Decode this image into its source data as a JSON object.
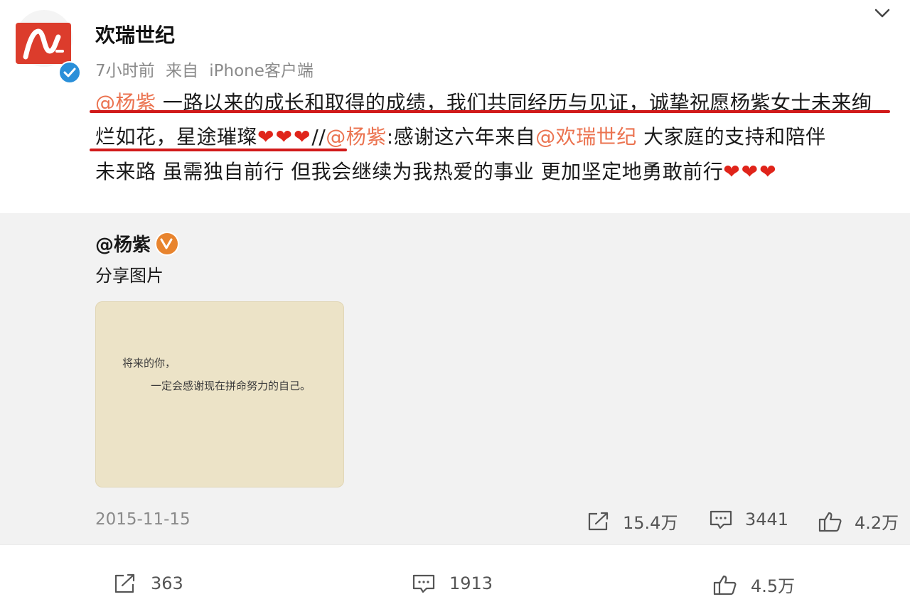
{
  "post": {
    "username": "欢瑞世纪",
    "time_ago": "7小时前",
    "source_prefix": "来自",
    "source_client": "iPhone客户端",
    "line1_mention": "@杨紫",
    "line1_text": " 一路以来的成长和取得的成绩，我们共同经历与见证，诚挚祝愿杨紫女士未来绚",
    "line2_text_a": "烂如花，星途璀璨",
    "hearts": "❤❤❤",
    "line2_sep": "//",
    "line2_mention1": "@杨紫",
    "line2_text_b": ":感谢这六年来自",
    "line2_mention2": "@欢瑞世纪",
    "line2_text_c": " 大家庭的支持和陪伴",
    "line3_text": "未来路 虽需独自前行 但我会继续为我热爱的事业 更加坚定地勇敢前行",
    "line3_hearts": "❤❤❤"
  },
  "repost": {
    "author": "@杨紫",
    "text": "分享图片",
    "photo_line1": "将来的你，",
    "photo_line2": "一定会感谢现在拼命努力的自己。",
    "date": "2015-11-15",
    "shares": "15.4万",
    "comments": "3441",
    "likes": "4.2万"
  },
  "bottom_bar": {
    "shares": "363",
    "comments": "1913",
    "likes": "4.5万"
  },
  "colors": {
    "mention": "#eb7350",
    "underline": "#d11a1a",
    "heart": "#e0241a",
    "verified_blue": "#2a8fd9",
    "verified_orange": "#e8842e"
  }
}
